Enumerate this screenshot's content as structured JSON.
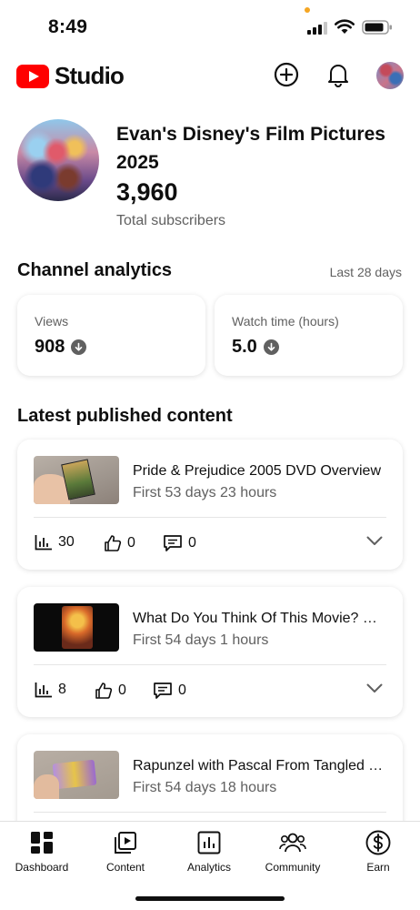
{
  "status_bar": {
    "time": "8:49"
  },
  "header": {
    "logo_text": "Studio",
    "brand_color": "#ff0000",
    "icons": [
      "create-plus-icon",
      "notifications-bell-icon",
      "account-avatar"
    ]
  },
  "profile": {
    "channel_name": "Evan's Disney's Film Pictures 2025",
    "subscriber_count": "3,960",
    "subscriber_label": "Total subscribers"
  },
  "analytics": {
    "title": "Channel analytics",
    "period": "Last 28 days",
    "metrics": [
      {
        "label": "Views",
        "value": "908",
        "trend": "down"
      },
      {
        "label": "Watch time (hours)",
        "value": "5.0",
        "trend": "down"
      }
    ]
  },
  "latest": {
    "title": "Latest published content",
    "videos": [
      {
        "title": "Pride & Prejudice 2005 DVD Overview",
        "subtitle": "First 53 days 23 hours",
        "views": "30",
        "likes": "0",
        "comments": "0"
      },
      {
        "title": "What Do You Think Of This Movie? Who Framed Roger Rabbit",
        "subtitle": "First 54 days 1 hours",
        "views": "8",
        "likes": "0",
        "comments": "0"
      },
      {
        "title": "Rapunzel with Pascal From Tangled Toy",
        "subtitle": "First 54 days 18 hours"
      }
    ]
  },
  "bottom_nav": {
    "items": [
      {
        "label": "Dashboard",
        "icon": "dashboard-icon",
        "active": true
      },
      {
        "label": "Content",
        "icon": "content-icon"
      },
      {
        "label": "Analytics",
        "icon": "analytics-icon"
      },
      {
        "label": "Community",
        "icon": "community-icon"
      },
      {
        "label": "Earn",
        "icon": "earn-dollar-icon"
      }
    ]
  }
}
